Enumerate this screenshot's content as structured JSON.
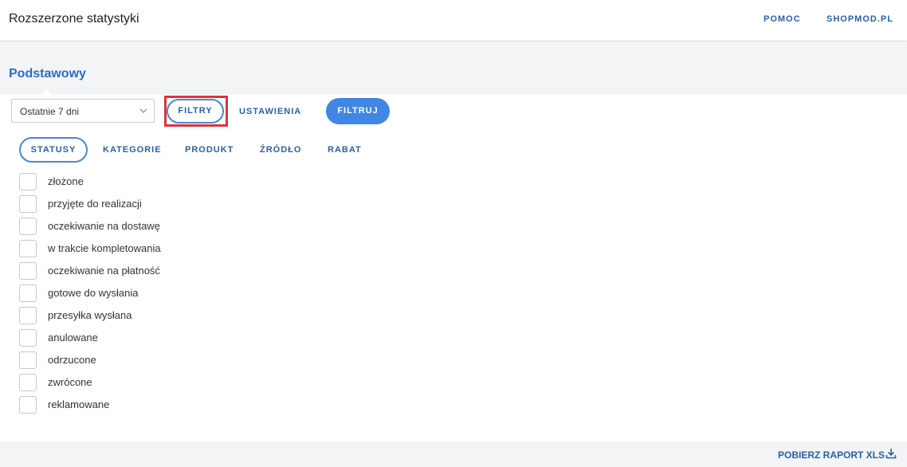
{
  "header": {
    "title": "Rozszerzone statystyki",
    "links": {
      "help": "POMOC",
      "shop": "SHOPMOD.PL"
    }
  },
  "section": {
    "title": "Podstawowy"
  },
  "toolbar": {
    "period_value": "Ostatnie 7 dni",
    "filters_label": "FILTRY",
    "settings_label": "USTAWIENIA",
    "apply_label": "FILTRUJ"
  },
  "filter_tabs": {
    "statusy": "STATUSY",
    "kategorie": "KATEGORIE",
    "produkt": "PRODUKT",
    "zrodlo": "ŹRÓDŁO",
    "rabat": "RABAT"
  },
  "statuses": [
    "złożone",
    "przyjęte do realizacji",
    "oczekiwanie na dostawę",
    "w trakcie kompletowania",
    "oczekiwanie na płatność",
    "gotowe do wysłania",
    "przesyłka wysłana",
    "anulowane",
    "odrzucone",
    "zwrócone",
    "reklamowane"
  ],
  "footer": {
    "download_label": "POBIERZ RAPORT XLS"
  },
  "colors": {
    "accent": "#3f86e5",
    "link": "#2a5fa8",
    "highlight": "#e0313c",
    "band": "#f3f4f6"
  },
  "icons": {
    "select_arrow": "chevron-down-icon",
    "download": "download-icon"
  }
}
